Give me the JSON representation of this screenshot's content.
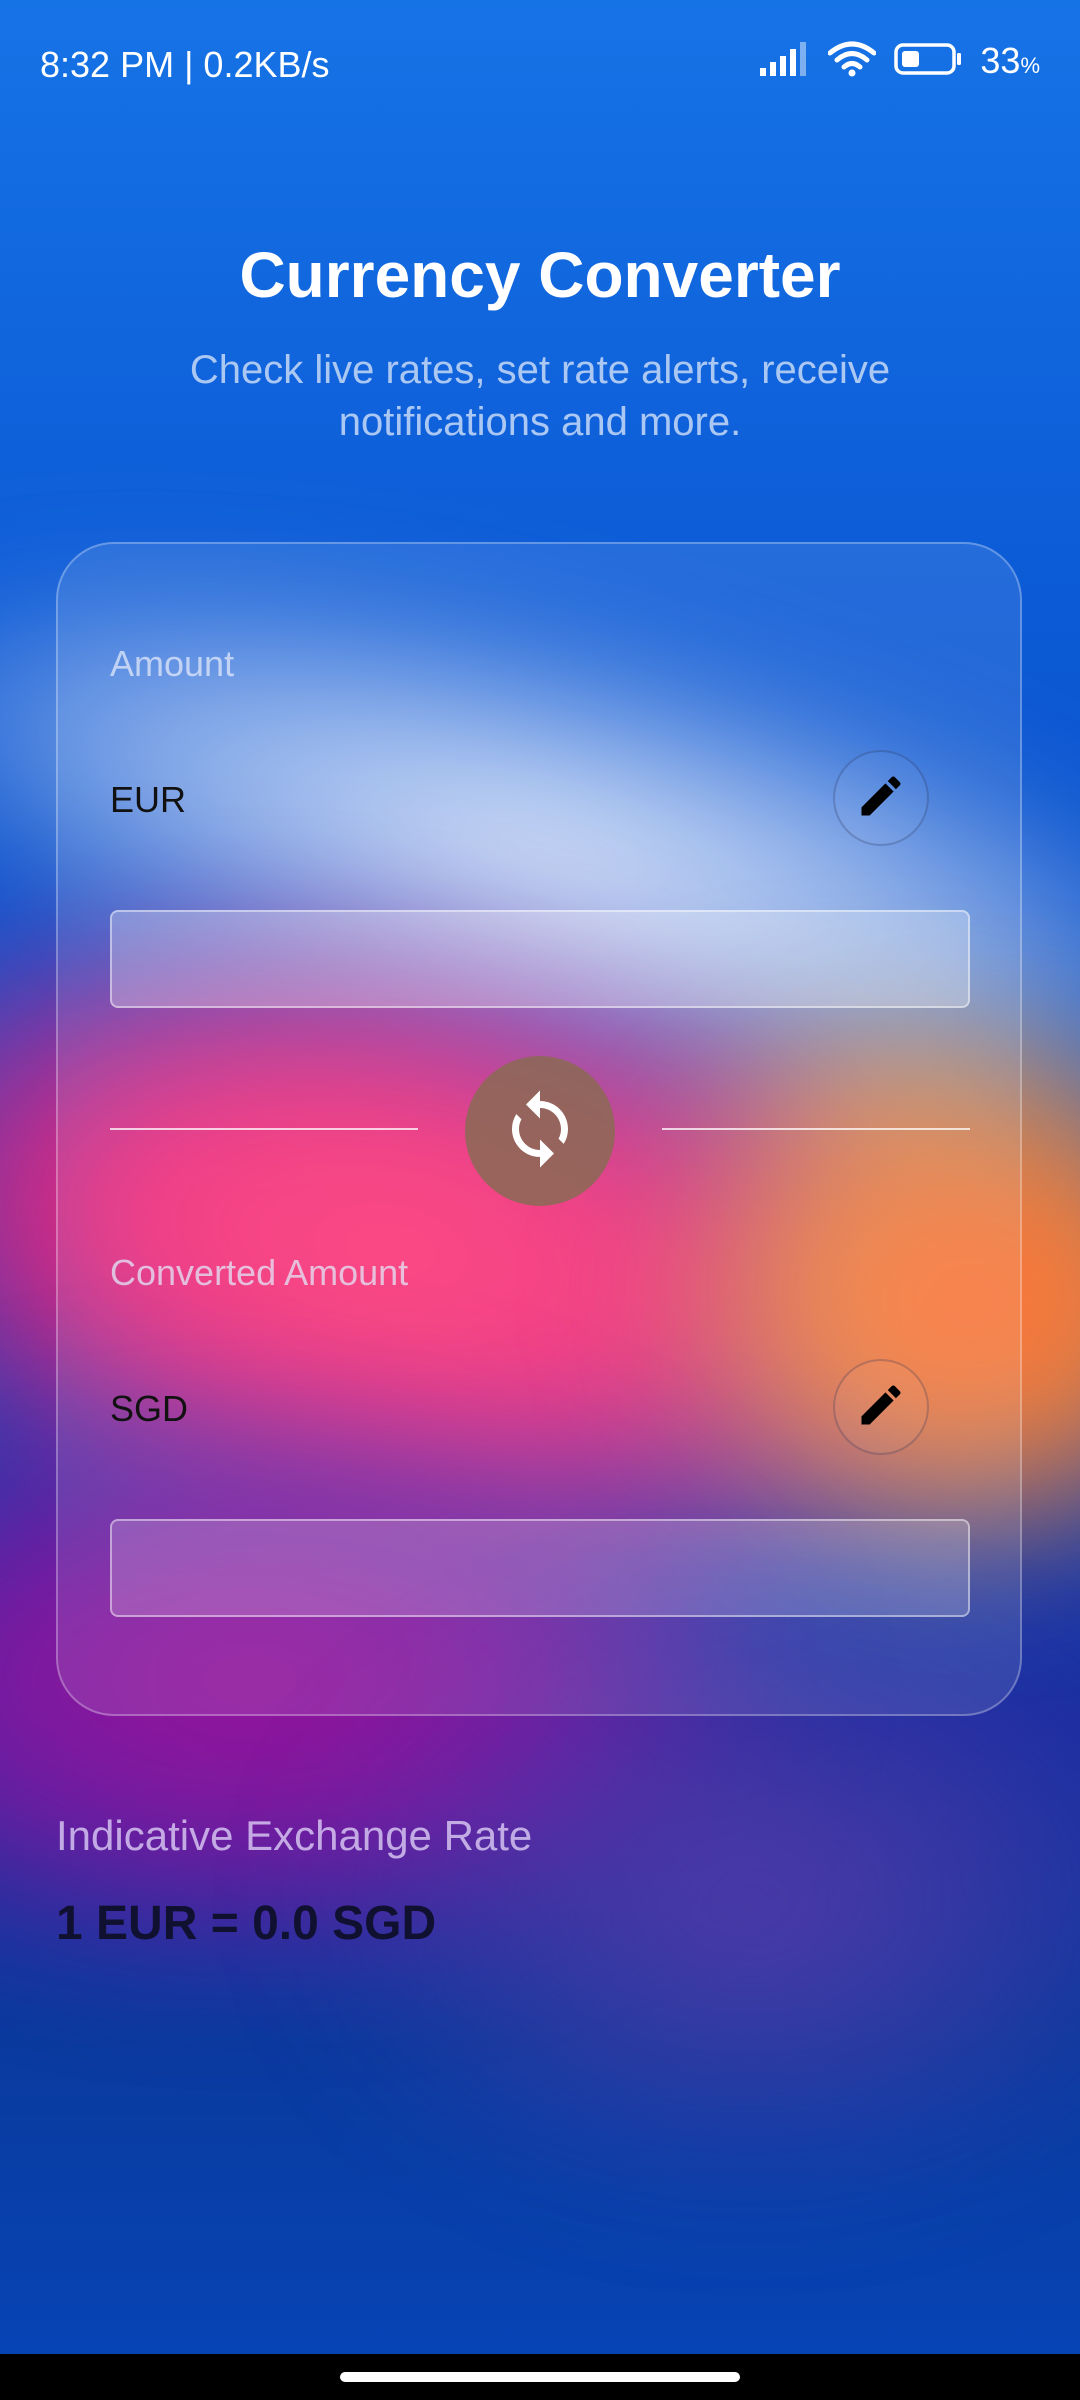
{
  "status_bar": {
    "time_speed": "8:32 PM | 0.2KB/s",
    "battery_percent": "33",
    "battery_unit": "%",
    "icons": [
      "signal-icon",
      "wifi-icon",
      "battery-icon"
    ]
  },
  "header": {
    "title": "Currency Converter",
    "subtitle": "Check live rates, set rate alerts, receive notifications and more."
  },
  "converter": {
    "amount_label": "Amount",
    "from_currency": "EUR",
    "from_value": "",
    "converted_label": "Converted Amount",
    "to_currency": "SGD",
    "to_value": ""
  },
  "rate": {
    "label": "Indicative Exchange Rate",
    "value": "1 EUR = 0.0 SGD"
  },
  "colors": {
    "background_top": "#1673e6",
    "accent_pink": "#ff3b74",
    "swap_button": "#8c6955"
  }
}
